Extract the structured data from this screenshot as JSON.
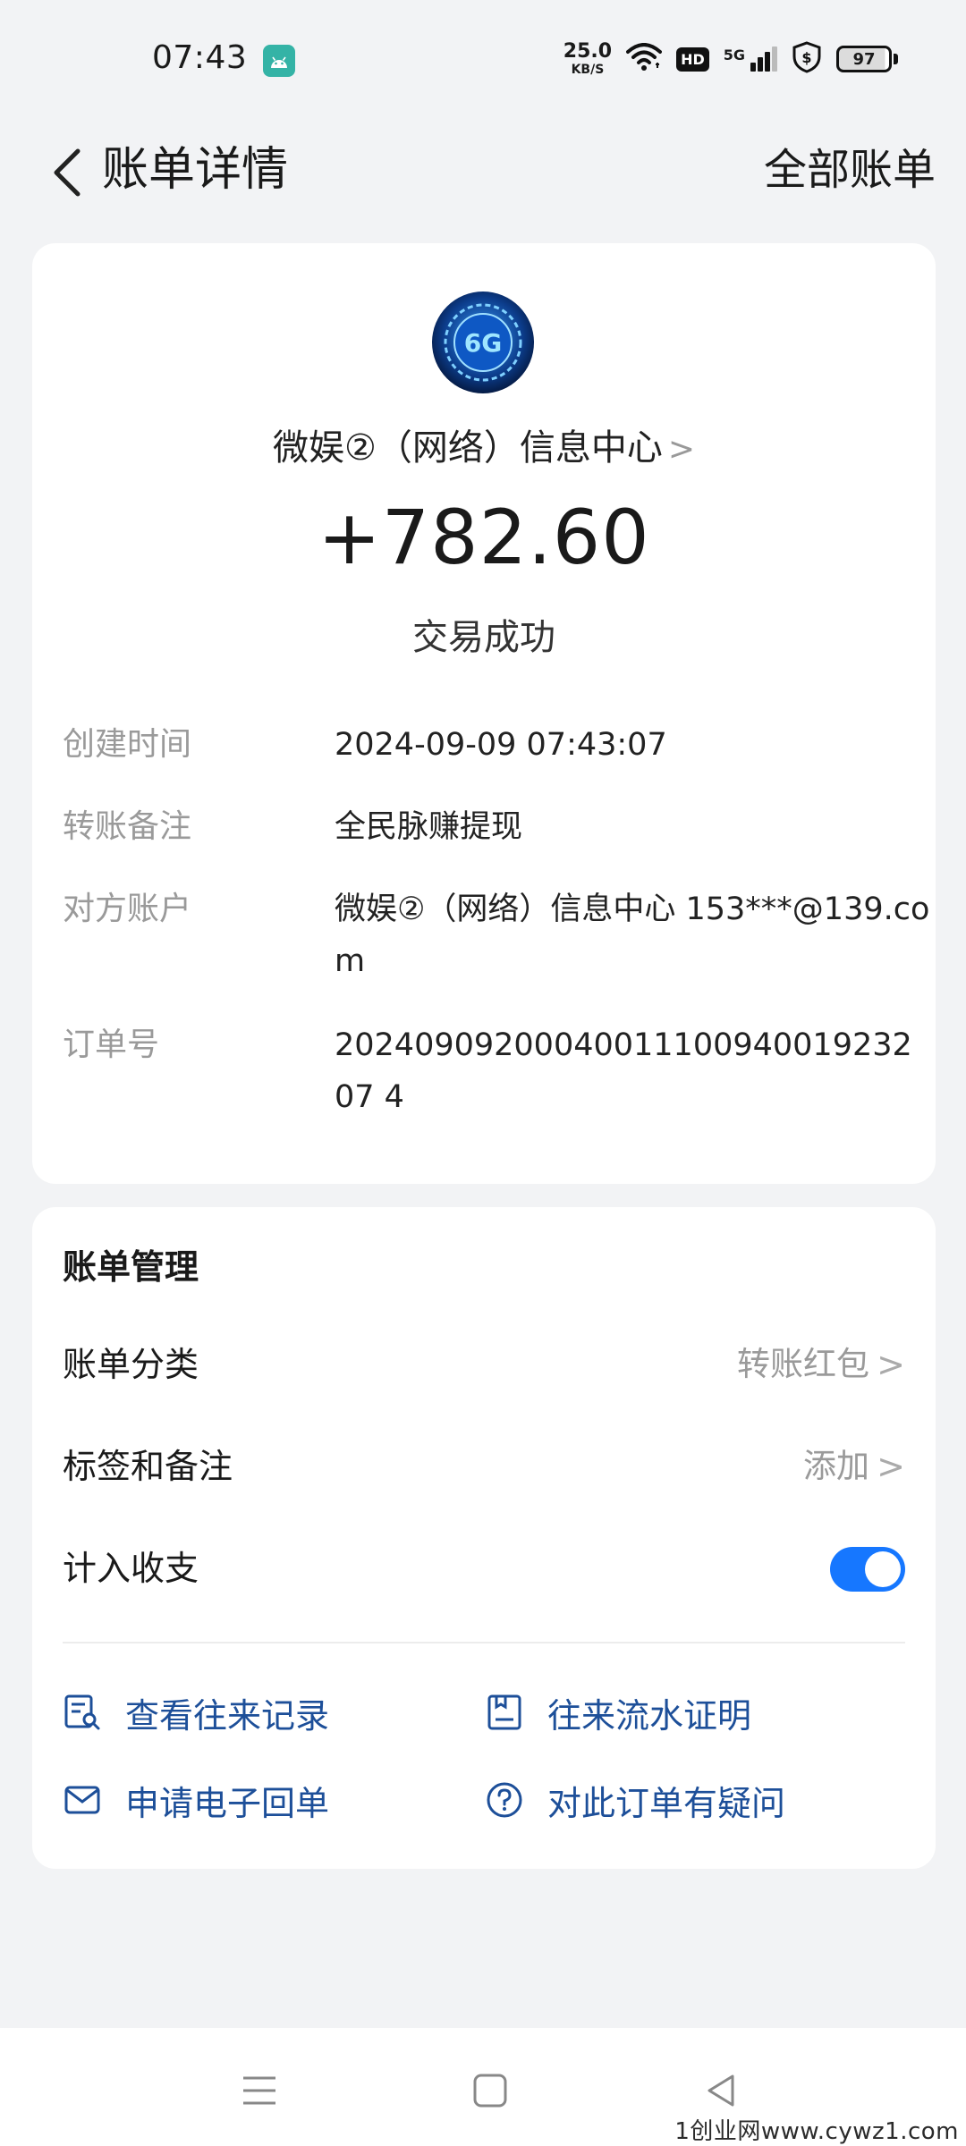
{
  "status_bar": {
    "time": "07:43",
    "net_speed_value": "25.0",
    "net_speed_unit": "KB/S",
    "hd": "HD",
    "network": "5G",
    "battery": "97"
  },
  "header": {
    "title": "账单详情",
    "right_link": "全部账单"
  },
  "transaction": {
    "merchant": "微娱②（网络）信息中心",
    "amount": "+782.60",
    "status": "交易成功"
  },
  "details": [
    {
      "label": "创建时间",
      "value": "2024-09-09 07:43:07"
    },
    {
      "label": "转账备注",
      "value": "全民脉赚提现"
    },
    {
      "label": "对方账户",
      "value": "微娱②（网络）信息中心 153***@139.com"
    },
    {
      "label": "订单号",
      "value": "2024090920004001110094001923207 4"
    }
  ],
  "manage": {
    "title": "账单管理",
    "category_label": "账单分类",
    "category_value": "转账红包",
    "tags_label": "标签和备注",
    "tags_value": "添加",
    "count_label": "计入收支",
    "count_enabled": true
  },
  "actions": [
    {
      "label": "查看往来记录",
      "icon": "search-record-icon"
    },
    {
      "label": "往来流水证明",
      "icon": "statement-icon"
    },
    {
      "label": "申请电子回单",
      "icon": "mail-icon"
    },
    {
      "label": "对此订单有疑问",
      "icon": "question-icon"
    }
  ],
  "watermark": "1创业网www.cywz1.com",
  "colors": {
    "accent": "#1677ff",
    "link": "#1d4f99",
    "background": "#f2f3f5"
  }
}
